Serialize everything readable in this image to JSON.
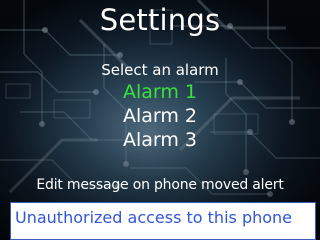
{
  "header": {
    "title": "Settings"
  },
  "alarms": {
    "prompt": "Select an alarm",
    "items": [
      {
        "label": "Alarm 1",
        "selected": true
      },
      {
        "label": "Alarm 2",
        "selected": false
      },
      {
        "label": "Alarm 3",
        "selected": false
      }
    ]
  },
  "moved_alert": {
    "label": "Edit message on phone moved alert",
    "message_value": "Unauthorized access to this phone"
  },
  "colors": {
    "selected_item": "#37e33a",
    "field_text": "#3156d8",
    "background": "#050c14"
  },
  "background_image": "circuit-board-pattern"
}
